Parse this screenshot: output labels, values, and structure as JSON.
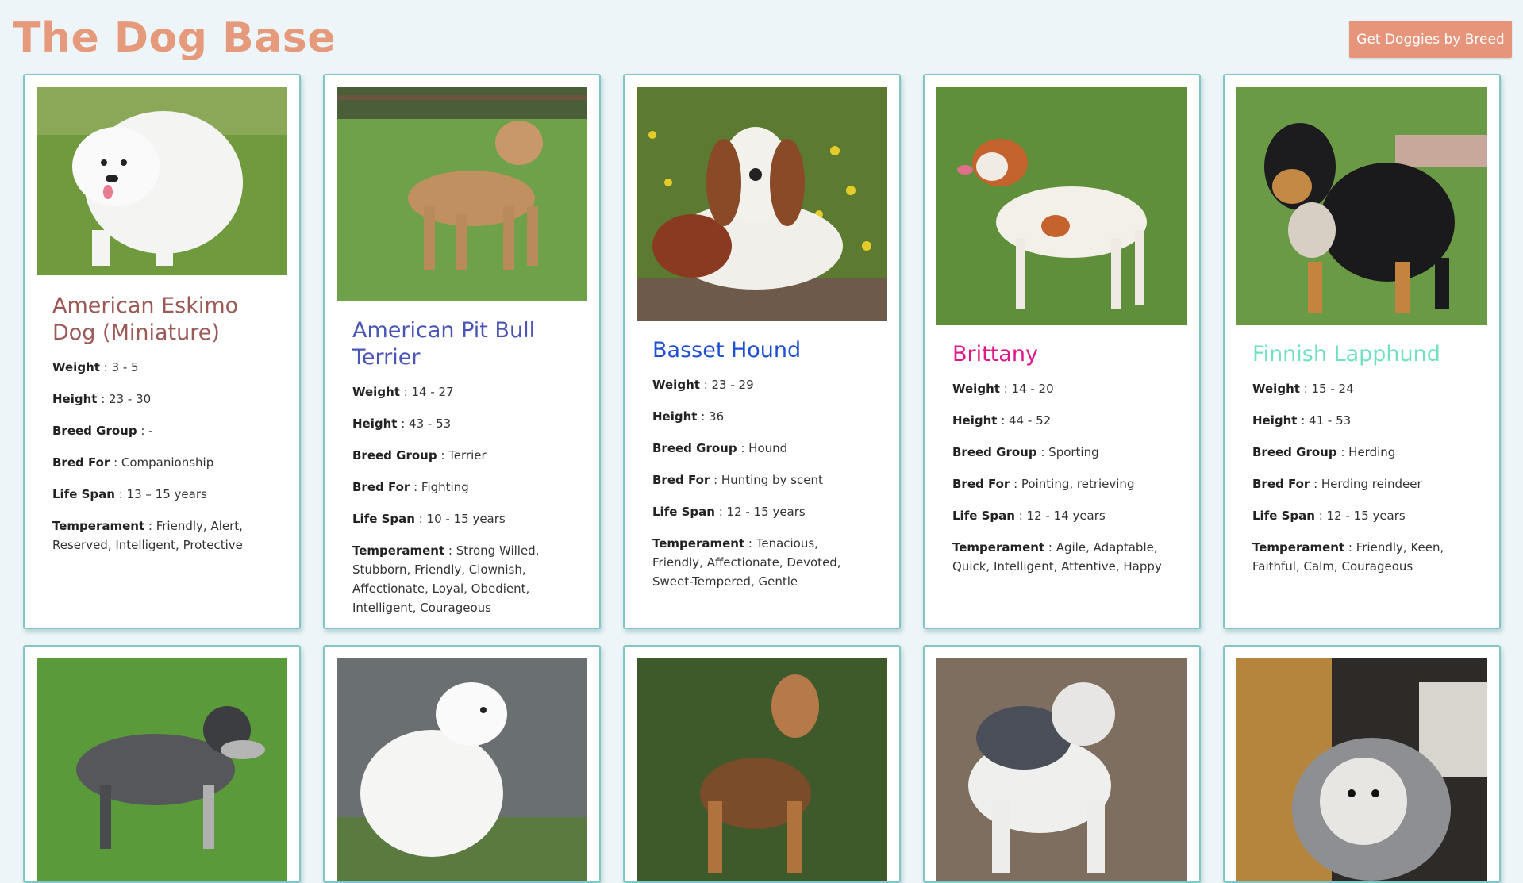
{
  "header": {
    "title": "The Dog Base",
    "button_label": "Get Doggies by Breed"
  },
  "labels": {
    "weight": "Weight",
    "height": "Height",
    "breed_group": "Breed Group",
    "bred_for": "Bred For",
    "life_span": "Life Span",
    "temperament": "Temperament"
  },
  "dogs": [
    {
      "name": "American Eskimo Dog (Miniature)",
      "name_color": "#9c5a56",
      "weight": " : 3 - 5",
      "height": " : 23 - 30",
      "breed_group": " : -",
      "bred_for": " : Companionship",
      "life_span": " : 13 – 15 years",
      "temperament": " : Friendly, Alert, Reserved, Intelligent, Protective",
      "photo_alt": "White fluffy dog on grass"
    },
    {
      "name": "American Pit Bull Terrier",
      "name_color": "#4a55b5",
      "weight": " : 14 - 27",
      "height": " : 43 - 53",
      "breed_group": " : Terrier",
      "bred_for": " : Fighting",
      "life_span": " : 10 - 15 years",
      "temperament": " : Strong Willed, Stubborn, Friendly, Clownish, Affectionate, Loyal, Obedient, Intelligent, Courageous",
      "photo_alt": "Tan pit bull standing on grass"
    },
    {
      "name": "Basset Hound",
      "name_color": "#1f4fd1",
      "weight": " : 23 - 29",
      "height": " : 36",
      "breed_group": " : Hound",
      "bred_for": " : Hunting by scent",
      "life_span": " : 12 - 15 years",
      "temperament": " : Tenacious, Friendly, Affectionate, Devoted, Sweet-Tempered, Gentle",
      "photo_alt": "Basset hound sitting among yellow flowers"
    },
    {
      "name": "Brittany",
      "name_color": "#e0178a",
      "weight": " : 14 - 20",
      "height": " : 44 - 52",
      "breed_group": " : Sporting",
      "bred_for": " : Pointing, retrieving",
      "life_span": " : 12 - 14 years",
      "temperament": " : Agile, Adaptable, Quick, Intelligent, Attentive, Happy",
      "photo_alt": "Orange and white Brittany on grass"
    },
    {
      "name": "Finnish Lapphund",
      "name_color": "#6fe0c1",
      "weight": " : 15 - 24",
      "height": " : 41 - 53",
      "breed_group": " : Herding",
      "bred_for": " : Herding reindeer",
      "life_span": " : 12 - 15 years",
      "temperament": " : Friendly, Keen, Faithful, Calm, Courageous",
      "photo_alt": "Black and tan Finnish Lapphund"
    }
  ],
  "row2_photos": [
    "Miniature schnauzer on grass",
    "White samoyed by water",
    "Airedale terrier by ivy",
    "Bulldog on dirt",
    "Shaggy sheepdog indoors"
  ],
  "colors": {
    "accent": "#e6947a",
    "card_border": "#83c6c7",
    "background": "#eef5f8"
  }
}
